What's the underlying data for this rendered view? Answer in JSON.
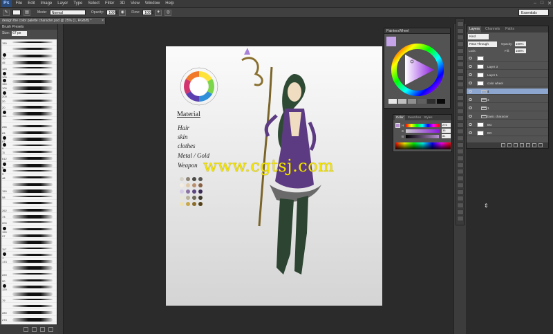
{
  "app": {
    "logo": "Ps",
    "menu": [
      "File",
      "Edit",
      "Image",
      "Layer",
      "Type",
      "Select",
      "Filter",
      "3D",
      "View",
      "Window",
      "Help"
    ],
    "window_controls": [
      "–",
      "□",
      "✕"
    ]
  },
  "options": {
    "mode_label": "Mode:",
    "mode_value": "Normal",
    "opacity_label": "Opacity:",
    "opacity_value": "100%",
    "flow_label": "Flow:",
    "flow_value": "100%",
    "workspace": "Essentials"
  },
  "document": {
    "tab_title": "design the color palette character.psd @ 25% (1, RGB/8) *",
    "close": "×"
  },
  "brush_panel": {
    "title": "Brush Presets",
    "size_label": "Size:",
    "size_value": "67 px",
    "rows": [
      {
        "num": "150",
        "kind": "stroke"
      },
      {
        "num": "",
        "kind": "stroke"
      },
      {
        "num": "70",
        "kind": "dot"
      },
      {
        "num": "45",
        "kind": "stroke"
      },
      {
        "num": "125",
        "kind": "stroke"
      },
      {
        "num": "100",
        "kind": "dot"
      },
      {
        "num": "150",
        "kind": "dot"
      },
      {
        "num": "100",
        "kind": "stroke"
      },
      {
        "num": "200",
        "kind": "dot"
      },
      {
        "num": "20",
        "kind": "stroke"
      },
      {
        "num": "20",
        "kind": "stroke"
      },
      {
        "num": "114",
        "kind": "dot"
      },
      {
        "num": "",
        "kind": "stroke"
      },
      {
        "num": "266",
        "kind": "stroke"
      },
      {
        "num": "83",
        "kind": "stroke"
      },
      {
        "num": "87",
        "kind": "dot"
      },
      {
        "num": "9",
        "kind": "dot"
      },
      {
        "num": "11",
        "kind": "stroke"
      },
      {
        "num": "612",
        "kind": "stroke"
      },
      {
        "num": "9",
        "kind": "dot"
      },
      {
        "num": "9",
        "kind": "dot"
      },
      {
        "num": "48",
        "kind": "stroke"
      },
      {
        "num": "",
        "kind": "stroke"
      },
      {
        "num": "150",
        "kind": "stroke"
      },
      {
        "num": "58",
        "kind": "stroke"
      },
      {
        "num": "",
        "kind": "stroke"
      },
      {
        "num": "262",
        "kind": "stroke"
      },
      {
        "num": "73",
        "kind": "stroke"
      },
      {
        "num": "200",
        "kind": "stroke"
      },
      {
        "num": "190",
        "kind": "dot"
      },
      {
        "num": "97",
        "kind": "stroke"
      },
      {
        "num": "",
        "kind": "stroke"
      },
      {
        "num": "117",
        "kind": "stroke"
      },
      {
        "num": "1",
        "kind": "dot"
      },
      {
        "num": "173",
        "kind": "stroke"
      },
      {
        "num": "",
        "kind": "stroke"
      },
      {
        "num": "220",
        "kind": "stroke"
      },
      {
        "num": "90",
        "kind": "stroke"
      },
      {
        "num": "120",
        "kind": "dot"
      },
      {
        "num": "",
        "kind": "stroke"
      },
      {
        "num": "79",
        "kind": "stroke"
      },
      {
        "num": "",
        "kind": "stroke"
      },
      {
        "num": "289",
        "kind": "stroke"
      },
      {
        "num": "273",
        "kind": "stroke"
      }
    ]
  },
  "canvas": {
    "material_title": "Material",
    "materials": [
      "Hair",
      "skin",
      "clothes",
      "Metal / Gold",
      "Weapon"
    ],
    "wheel_labels": [
      "G",
      "Y",
      "YG",
      "B",
      "R",
      "SC",
      "SC",
      "SC"
    ],
    "watermark": "www.cgtsj.com"
  },
  "painters_wheel": {
    "title": "PaintersWheel"
  },
  "color_panel": {
    "tabs": [
      "Color",
      "Swatches",
      "Styles"
    ],
    "channels": [
      {
        "k": "H",
        "v": "276"
      },
      {
        "k": "S",
        "v": "35"
      },
      {
        "k": "B",
        "v": "81"
      }
    ],
    "units": [
      "°",
      "%",
      "%"
    ]
  },
  "layers": {
    "tabs": [
      "Layers",
      "Channels",
      "Paths"
    ],
    "kind": "Kind",
    "blend": "Pass Through",
    "opacity_label": "Opacity:",
    "opacity_value": "100%",
    "lock_label": "Lock:",
    "fill_label": "Fill:",
    "fill_value": "100%",
    "rows": [
      {
        "name": "",
        "type": "layer",
        "sel": false
      },
      {
        "name": "Layer 3",
        "type": "layer",
        "sel": false
      },
      {
        "name": "Layer 1",
        "type": "layer",
        "sel": false
      },
      {
        "name": "color wheel",
        "type": "layer",
        "sel": false
      },
      {
        "name": "4",
        "type": "folder",
        "sel": true
      },
      {
        "name": "3",
        "type": "folder",
        "sel": false
      },
      {
        "name": "1",
        "type": "folder",
        "sel": false
      },
      {
        "name": "basic character",
        "type": "folder",
        "sel": false
      },
      {
        "name": "BG",
        "type": "layer",
        "sel": false
      },
      {
        "name": "BG",
        "type": "layer",
        "sel": false
      }
    ]
  },
  "colors": {
    "selection": "#8da6cf",
    "panel": "#535353",
    "watermark": "#f4e400",
    "fg_swatch": "#b58fd0"
  },
  "icons": [
    "brush-icon",
    "eye-icon",
    "folder-icon",
    "link-icon",
    "fx-icon",
    "mask-icon",
    "new-layer-icon",
    "trash-icon"
  ]
}
